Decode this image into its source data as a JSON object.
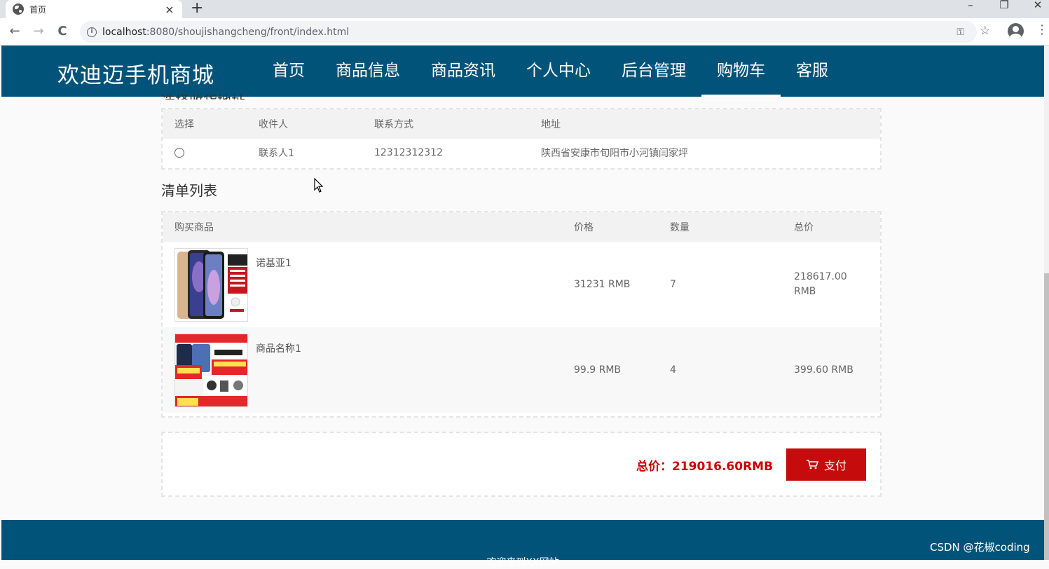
{
  "browser": {
    "tab_title": "首页",
    "tab_close": "×",
    "new_tab": "+",
    "url_host": "localhost",
    "url_path": ":8080/shoujishangcheng/front/index.html",
    "window_controls": [
      "–",
      "❐",
      "✕"
    ],
    "nav_buttons": {
      "back": "←",
      "forward": "→",
      "reload": "C"
    }
  },
  "site": {
    "brand": "欢迪迈手机商城",
    "nav": [
      {
        "label": "首页",
        "active": false
      },
      {
        "label": "商品信息",
        "active": false
      },
      {
        "label": "商品资讯",
        "active": false
      },
      {
        "label": "个人中心",
        "active": false
      },
      {
        "label": "后台管理",
        "active": false
      },
      {
        "label": "购物车",
        "active": true
      },
      {
        "label": "客服",
        "active": false
      }
    ]
  },
  "address_section": {
    "heading": "选择收货地址",
    "columns": [
      "选择",
      "收件人",
      "联系方式",
      "地址"
    ],
    "rows": [
      {
        "recipient": "联系人1",
        "phone": "12312312312",
        "address": "陕西省安康市旬阳市小河镇闫家坪",
        "selected": false
      }
    ]
  },
  "order_section": {
    "heading": "清单列表",
    "columns": [
      "购买商品",
      "价格",
      "数量",
      "总价"
    ],
    "rows": [
      {
        "name": "诺基亚1",
        "price": "31231 RMB",
        "qty": "7",
        "total_line1": "218617.00",
        "total_line2": "RMB",
        "image": "iphone-xs-max-image"
      },
      {
        "name": "商品名称1",
        "price": "99.9 RMB",
        "qty": "4",
        "total_line1": "399.60 RMB",
        "total_line2": "",
        "image": "redmi-k40-pro-image"
      }
    ],
    "grand_total": "总价：219016.60RMB",
    "pay_label": "支付"
  },
  "footer": {
    "text": "欢迎来到XX网站"
  },
  "watermark": "CSDN @花椒coding",
  "colors": {
    "header_bg": "#02537a",
    "pay_button": "#c50b0b",
    "total_text": "#cc0000"
  }
}
